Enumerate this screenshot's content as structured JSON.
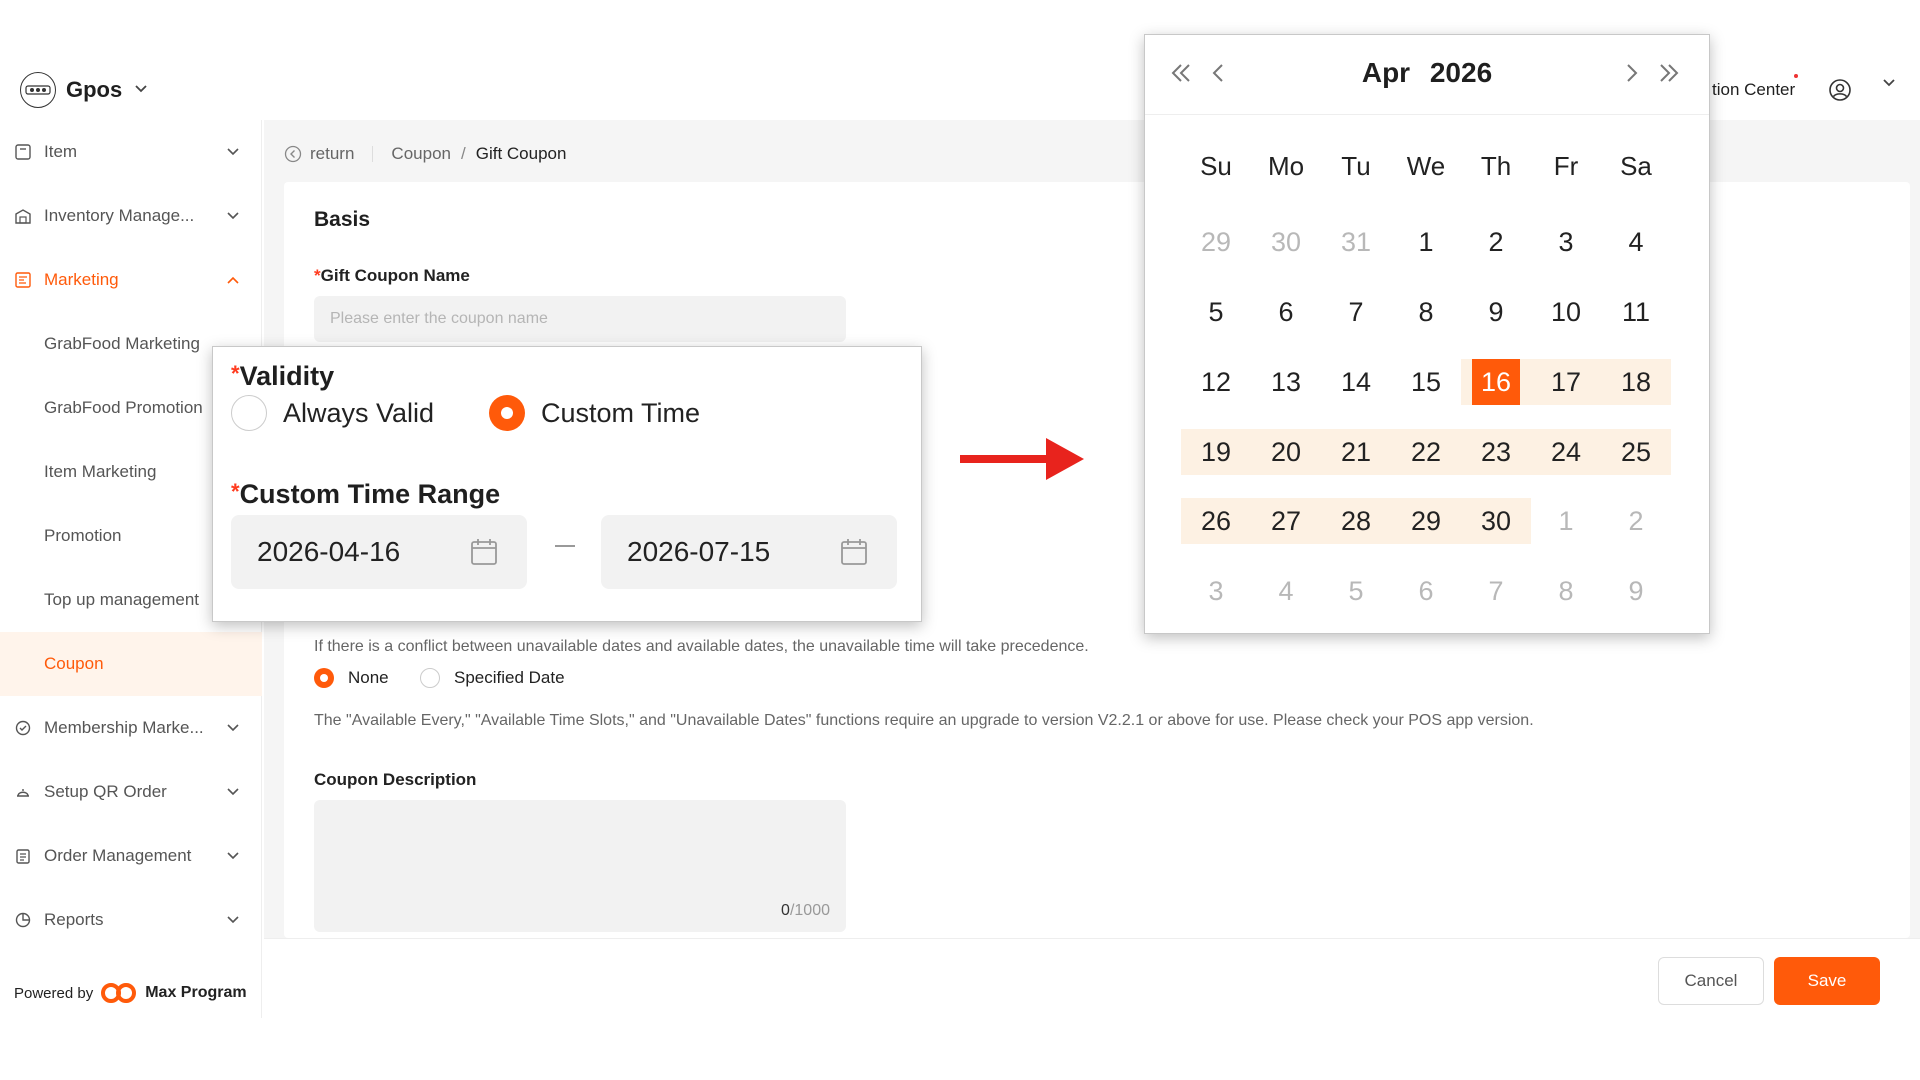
{
  "header": {
    "brand_name": "Gpos",
    "notification_label": "tion Center"
  },
  "sidebar": {
    "items": [
      {
        "label": "Item",
        "icon": "box-icon"
      },
      {
        "label": "Inventory Manage...",
        "icon": "warehouse-icon"
      },
      {
        "label": "Marketing",
        "icon": "marketing-icon"
      },
      {
        "label": "GrabFood Marketing"
      },
      {
        "label": "GrabFood Promotion"
      },
      {
        "label": "Item Marketing"
      },
      {
        "label": "Promotion"
      },
      {
        "label": "Top up management"
      },
      {
        "label": "Coupon"
      },
      {
        "label": "Membership Marke...",
        "icon": "membership-icon"
      },
      {
        "label": "Setup QR Order",
        "icon": "qr-order-icon"
      },
      {
        "label": "Order Management",
        "icon": "clipboard-icon"
      },
      {
        "label": "Reports",
        "icon": "pie-chart-icon"
      }
    ],
    "powered_by": "Powered by",
    "powered_brand": "Max Program"
  },
  "breadcrumb": {
    "return_label": "return",
    "parent": "Coupon",
    "separator": "/",
    "current": "Gift Coupon"
  },
  "form": {
    "section_title": "Basis",
    "name_label": "Gift Coupon Name",
    "name_placeholder": "Please enter the coupon name",
    "conflict_note": "If there is a conflict between unavailable dates and available dates, the unavailable time will take precedence.",
    "unavailable_options": [
      "None",
      "Specified Date"
    ],
    "version_note": "The \"Available Every,\" \"Available Time Slots,\" and \"Unavailable Dates\" functions require an upgrade to version V2.2.1 or above for use. Please check your POS app version.",
    "description_label": "Coupon Description",
    "description_count": "0",
    "description_max": "/1000"
  },
  "zoom": {
    "validity_label": "Validity",
    "option_always": "Always Valid",
    "option_custom": "Custom Time",
    "range_label": "Custom Time Range",
    "start_date": "2026-04-16",
    "end_date": "2026-07-15"
  },
  "calendar": {
    "month": "Apr",
    "year": "2026",
    "weekdays": [
      "Su",
      "Mo",
      "Tu",
      "We",
      "Th",
      "Fr",
      "Sa"
    ],
    "days": [
      "29",
      "30",
      "31",
      "1",
      "2",
      "3",
      "4",
      "5",
      "6",
      "7",
      "8",
      "9",
      "10",
      "11",
      "12",
      "13",
      "14",
      "15",
      "16",
      "17",
      "18",
      "19",
      "20",
      "21",
      "22",
      "23",
      "24",
      "25",
      "26",
      "27",
      "28",
      "29",
      "30",
      "1",
      "2",
      "3",
      "4",
      "5",
      "6",
      "7",
      "8",
      "9"
    ],
    "selected_index": 18,
    "range_start_index": 18,
    "range_end_index": 32,
    "muted_indices": [
      0,
      1,
      2,
      33,
      34,
      35,
      36,
      37,
      38,
      39,
      40,
      41
    ]
  },
  "footer": {
    "cancel_label": "Cancel",
    "save_label": "Save"
  },
  "colors": {
    "accent": "#ff5a0a",
    "range_bg": "#fdf1e3",
    "required": "#ff3b1f"
  }
}
